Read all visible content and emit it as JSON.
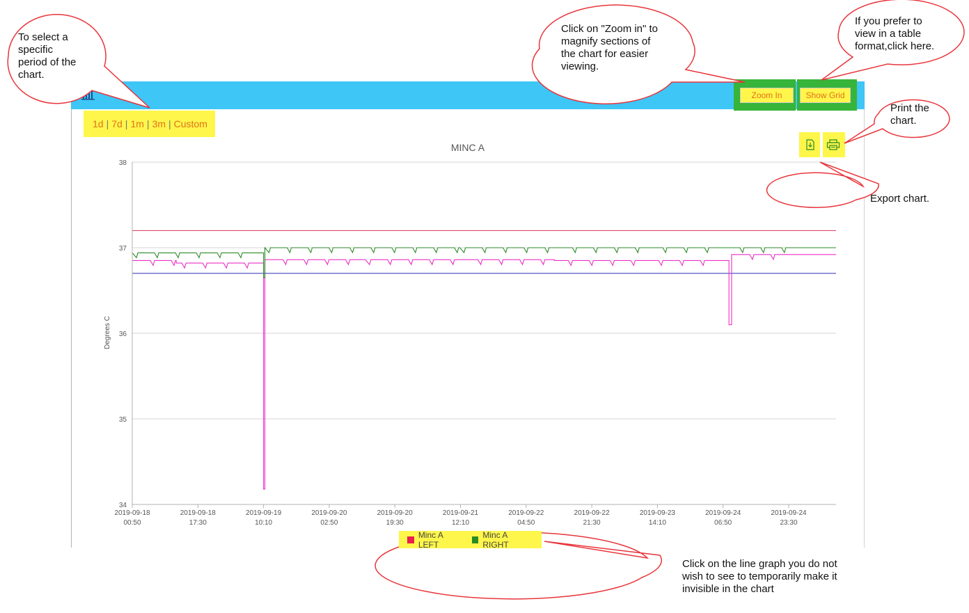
{
  "toolbar": {
    "ranges": [
      "1d",
      "7d",
      "1m",
      "3m",
      "Custom"
    ],
    "separator": "|",
    "zoom_label": "Zoom In",
    "grid_label": "Show Grid"
  },
  "icons": {
    "chart": "bar-chart-icon",
    "export": "export-icon",
    "print": "print-icon"
  },
  "colors": {
    "header": "#3ec6f6",
    "highlight": "#fef64a",
    "highlight_border": "#37b43a",
    "callout_border": "#e8353b",
    "series_left": "#ee2ec8",
    "series_right": "#2a8a25",
    "limit_high": "#d3325a",
    "limit_low": "#2c2cb0"
  },
  "chart_data": {
    "type": "line",
    "title": "MINC A",
    "ylabel": "Degrees C",
    "ylim": [
      34,
      38
    ],
    "yticks": [
      34,
      35,
      36,
      37,
      38
    ],
    "xlim": [
      "2019-09-18 00:50",
      "2019-09-24 23:30"
    ],
    "xticks": [
      [
        "2019-09-18",
        "00:50"
      ],
      [
        "2019-09-18",
        "17:30"
      ],
      [
        "2019-09-19",
        "10:10"
      ],
      [
        "2019-09-20",
        "02:50"
      ],
      [
        "2019-09-20",
        "19:30"
      ],
      [
        "2019-09-21",
        "12:10"
      ],
      [
        "2019-09-22",
        "04:50"
      ],
      [
        "2019-09-22",
        "21:30"
      ],
      [
        "2019-09-23",
        "14:10"
      ],
      [
        "2019-09-24",
        "06:50"
      ],
      [
        "2019-09-24",
        "23:30"
      ]
    ],
    "threshold_lines": [
      37.2,
      36.7
    ],
    "series": [
      {
        "name": "Minc A LEFT",
        "color": "#ee2ec8",
        "points": [
          [
            "2019-09-18 00:50",
            36.85
          ],
          [
            "2019-09-18 12:00",
            36.82
          ],
          [
            "2019-09-19 08:00",
            36.82
          ],
          [
            "2019-09-19 10:10",
            34.18
          ],
          [
            "2019-09-19 10:30",
            36.86
          ],
          [
            "2019-09-20 12:00",
            36.86
          ],
          [
            "2019-09-21 12:00",
            36.86
          ],
          [
            "2019-09-22 12:00",
            36.85
          ],
          [
            "2019-09-23 12:00",
            36.85
          ],
          [
            "2019-09-24 06:30",
            36.85
          ],
          [
            "2019-09-24 08:20",
            36.1
          ],
          [
            "2019-09-24 09:00",
            36.92
          ],
          [
            "2019-09-24 23:30",
            36.92
          ]
        ]
      },
      {
        "name": "Minc A RIGHT",
        "color": "#2a8a25",
        "points": [
          [
            "2019-09-18 00:50",
            36.94
          ],
          [
            "2019-09-19 08:00",
            36.94
          ],
          [
            "2019-09-19 10:10",
            36.65
          ],
          [
            "2019-09-19 10:30",
            37.0
          ],
          [
            "2019-09-20 12:00",
            37.0
          ],
          [
            "2019-09-21 12:00",
            37.0
          ],
          [
            "2019-09-22 12:00",
            37.0
          ],
          [
            "2019-09-23 12:00",
            37.0
          ],
          [
            "2019-09-24 06:30",
            37.0
          ],
          [
            "2019-09-24 23:30",
            37.0
          ]
        ]
      }
    ],
    "legend": [
      "Minc A LEFT",
      "Minc A RIGHT"
    ],
    "legend_position": "bottom",
    "grid": true
  },
  "callouts": {
    "period": [
      "To select a",
      "specific",
      "period of the",
      "chart."
    ],
    "zoom": [
      "Click on \"Zoom in\" to",
      "magnify sections of",
      "the chart for easier",
      "viewing."
    ],
    "table": [
      "If you prefer to",
      "view in a table",
      "format,click here."
    ],
    "print": [
      "Print the",
      "chart."
    ],
    "export": [
      "Export chart."
    ],
    "legend": [
      "Click on the line graph you do not",
      "wish to see to temporarily make it",
      "invisible in the chart"
    ]
  }
}
